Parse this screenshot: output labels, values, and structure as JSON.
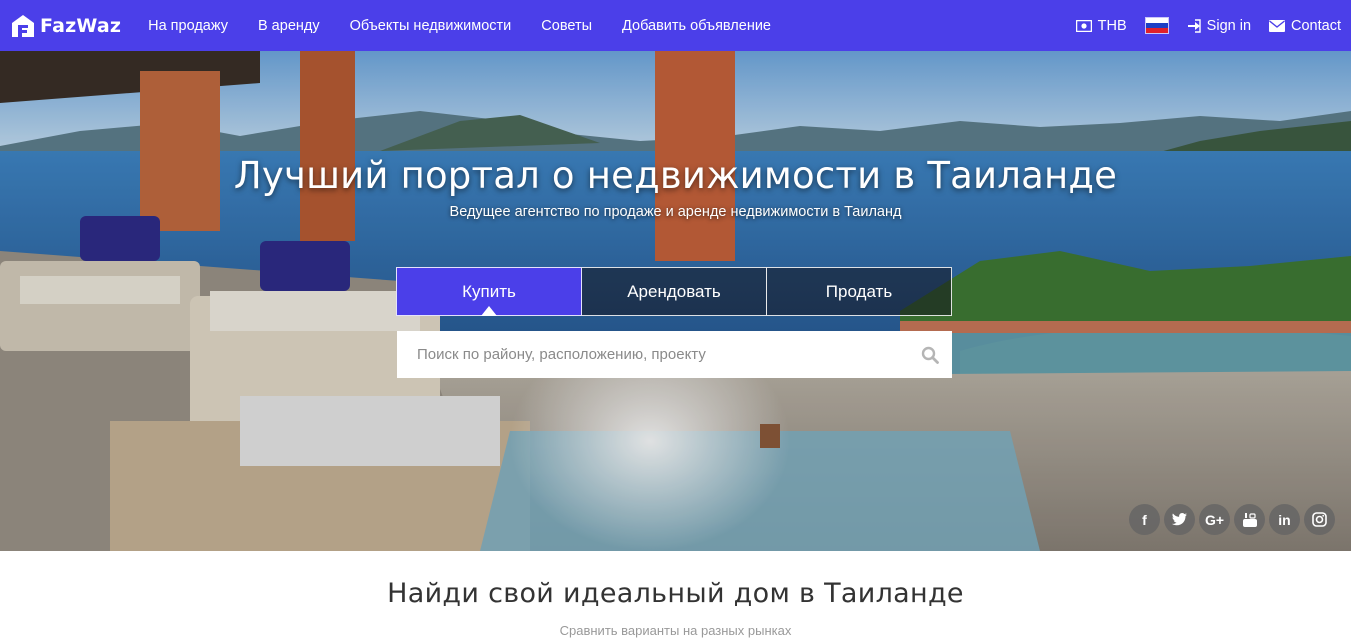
{
  "brand": {
    "name": "FazWaz"
  },
  "nav": {
    "links": [
      "На продажу",
      "В аренду",
      "Объекты недвижимости",
      "Советы",
      "Добавить объявление"
    ],
    "currency": "THB",
    "signin": "Sign in",
    "contact": "Contact"
  },
  "hero": {
    "title": "Лучший портал о недвижимости в Таиланде",
    "subtitle": "Ведущее агентство по продаже и аренде недвижимости в Таиланд",
    "tabs": [
      "Купить",
      "Арендовать",
      "Продать"
    ],
    "active_tab": "Купить",
    "search_placeholder": "Поиск по району, расположению, проекту"
  },
  "socials": [
    "facebook-icon",
    "twitter-icon",
    "google-plus-icon",
    "youtube-icon",
    "linkedin-icon",
    "instagram-icon"
  ],
  "section": {
    "title": "Найди свой идеальный дом в Таиланде",
    "subtitle": "Сравнить варианты на разных рынках"
  },
  "colors": {
    "brand": "#4b3fe9",
    "nav_text": "#ffffff"
  }
}
